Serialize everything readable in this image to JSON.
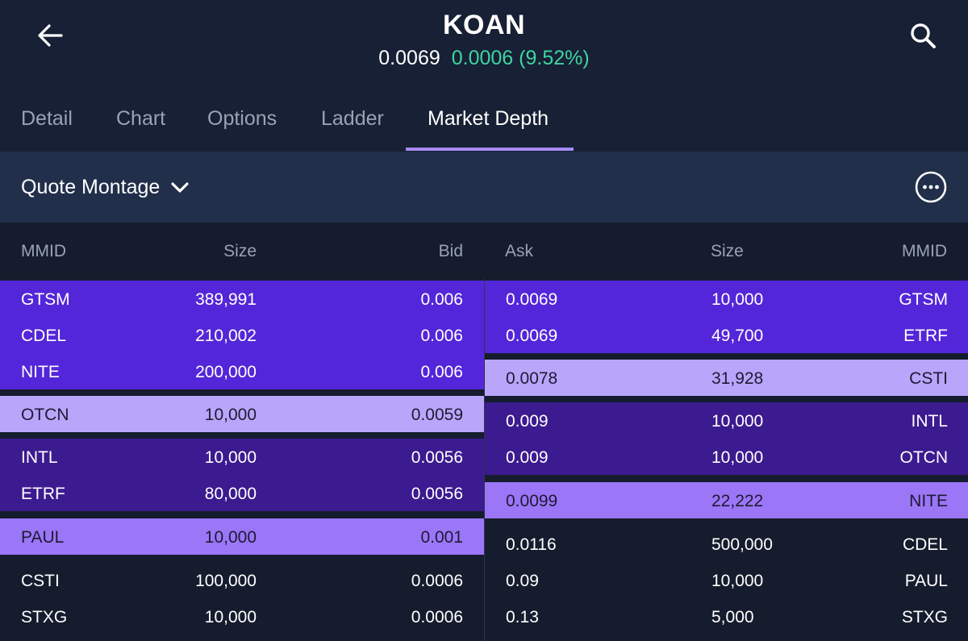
{
  "header": {
    "symbol": "KOAN",
    "last_price": "0.0069",
    "change": "0.0006 (9.52%)",
    "back_icon": "arrow-left-icon",
    "search_icon": "search-icon"
  },
  "tabs": [
    {
      "label": "Detail"
    },
    {
      "label": "Chart"
    },
    {
      "label": "Options"
    },
    {
      "label": "Ladder"
    },
    {
      "label": "Market Depth",
      "active": true
    }
  ],
  "toolbar": {
    "view_label": "Quote Montage",
    "dropdown_icon": "chevron-down-icon",
    "more_icon": "more-horizontal-icon"
  },
  "columns": {
    "bid_mmid": "MMID",
    "bid_size": "Size",
    "bid": "Bid",
    "ask": "Ask",
    "ask_size": "Size",
    "ask_mmid": "MMID"
  },
  "bids": [
    {
      "mmid": "GTSM",
      "size": "389,991",
      "price": "0.006"
    },
    {
      "mmid": "CDEL",
      "size": "210,002",
      "price": "0.006"
    },
    {
      "mmid": "NITE",
      "size": "200,000",
      "price": "0.006"
    },
    {
      "mmid": "OTCN",
      "size": "10,000",
      "price": "0.0059"
    },
    {
      "mmid": "INTL",
      "size": "10,000",
      "price": "0.0056"
    },
    {
      "mmid": "ETRF",
      "size": "80,000",
      "price": "0.0056"
    },
    {
      "mmid": "PAUL",
      "size": "10,000",
      "price": "0.001"
    },
    {
      "mmid": "CSTI",
      "size": "100,000",
      "price": "0.0006"
    },
    {
      "mmid": "STXG",
      "size": "10,000",
      "price": "0.0006"
    }
  ],
  "asks": [
    {
      "price": "0.0069",
      "size": "10,000",
      "mmid": "GTSM"
    },
    {
      "price": "0.0069",
      "size": "49,700",
      "mmid": "ETRF"
    },
    {
      "price": "0.0078",
      "size": "31,928",
      "mmid": "CSTI"
    },
    {
      "price": "0.009",
      "size": "10,000",
      "mmid": "INTL"
    },
    {
      "price": "0.009",
      "size": "10,000",
      "mmid": "OTCN"
    },
    {
      "price": "0.0099",
      "size": "22,222",
      "mmid": "NITE"
    },
    {
      "price": "0.0116",
      "size": "500,000",
      "mmid": "CDEL"
    },
    {
      "price": "0.09",
      "size": "10,000",
      "mmid": "PAUL"
    },
    {
      "price": "0.13",
      "size": "5,000",
      "mmid": "STXG"
    }
  ],
  "colors": {
    "background": "#172034",
    "toolbar": "#212f4a",
    "table_bg": "#151c2d",
    "level1": "#5426d9",
    "level2": "#b9a6fb",
    "level3": "#3c1a8f",
    "level4": "#9b76f7",
    "positive_change": "#3fd4a0",
    "tab_underline": "#a78bfa"
  }
}
